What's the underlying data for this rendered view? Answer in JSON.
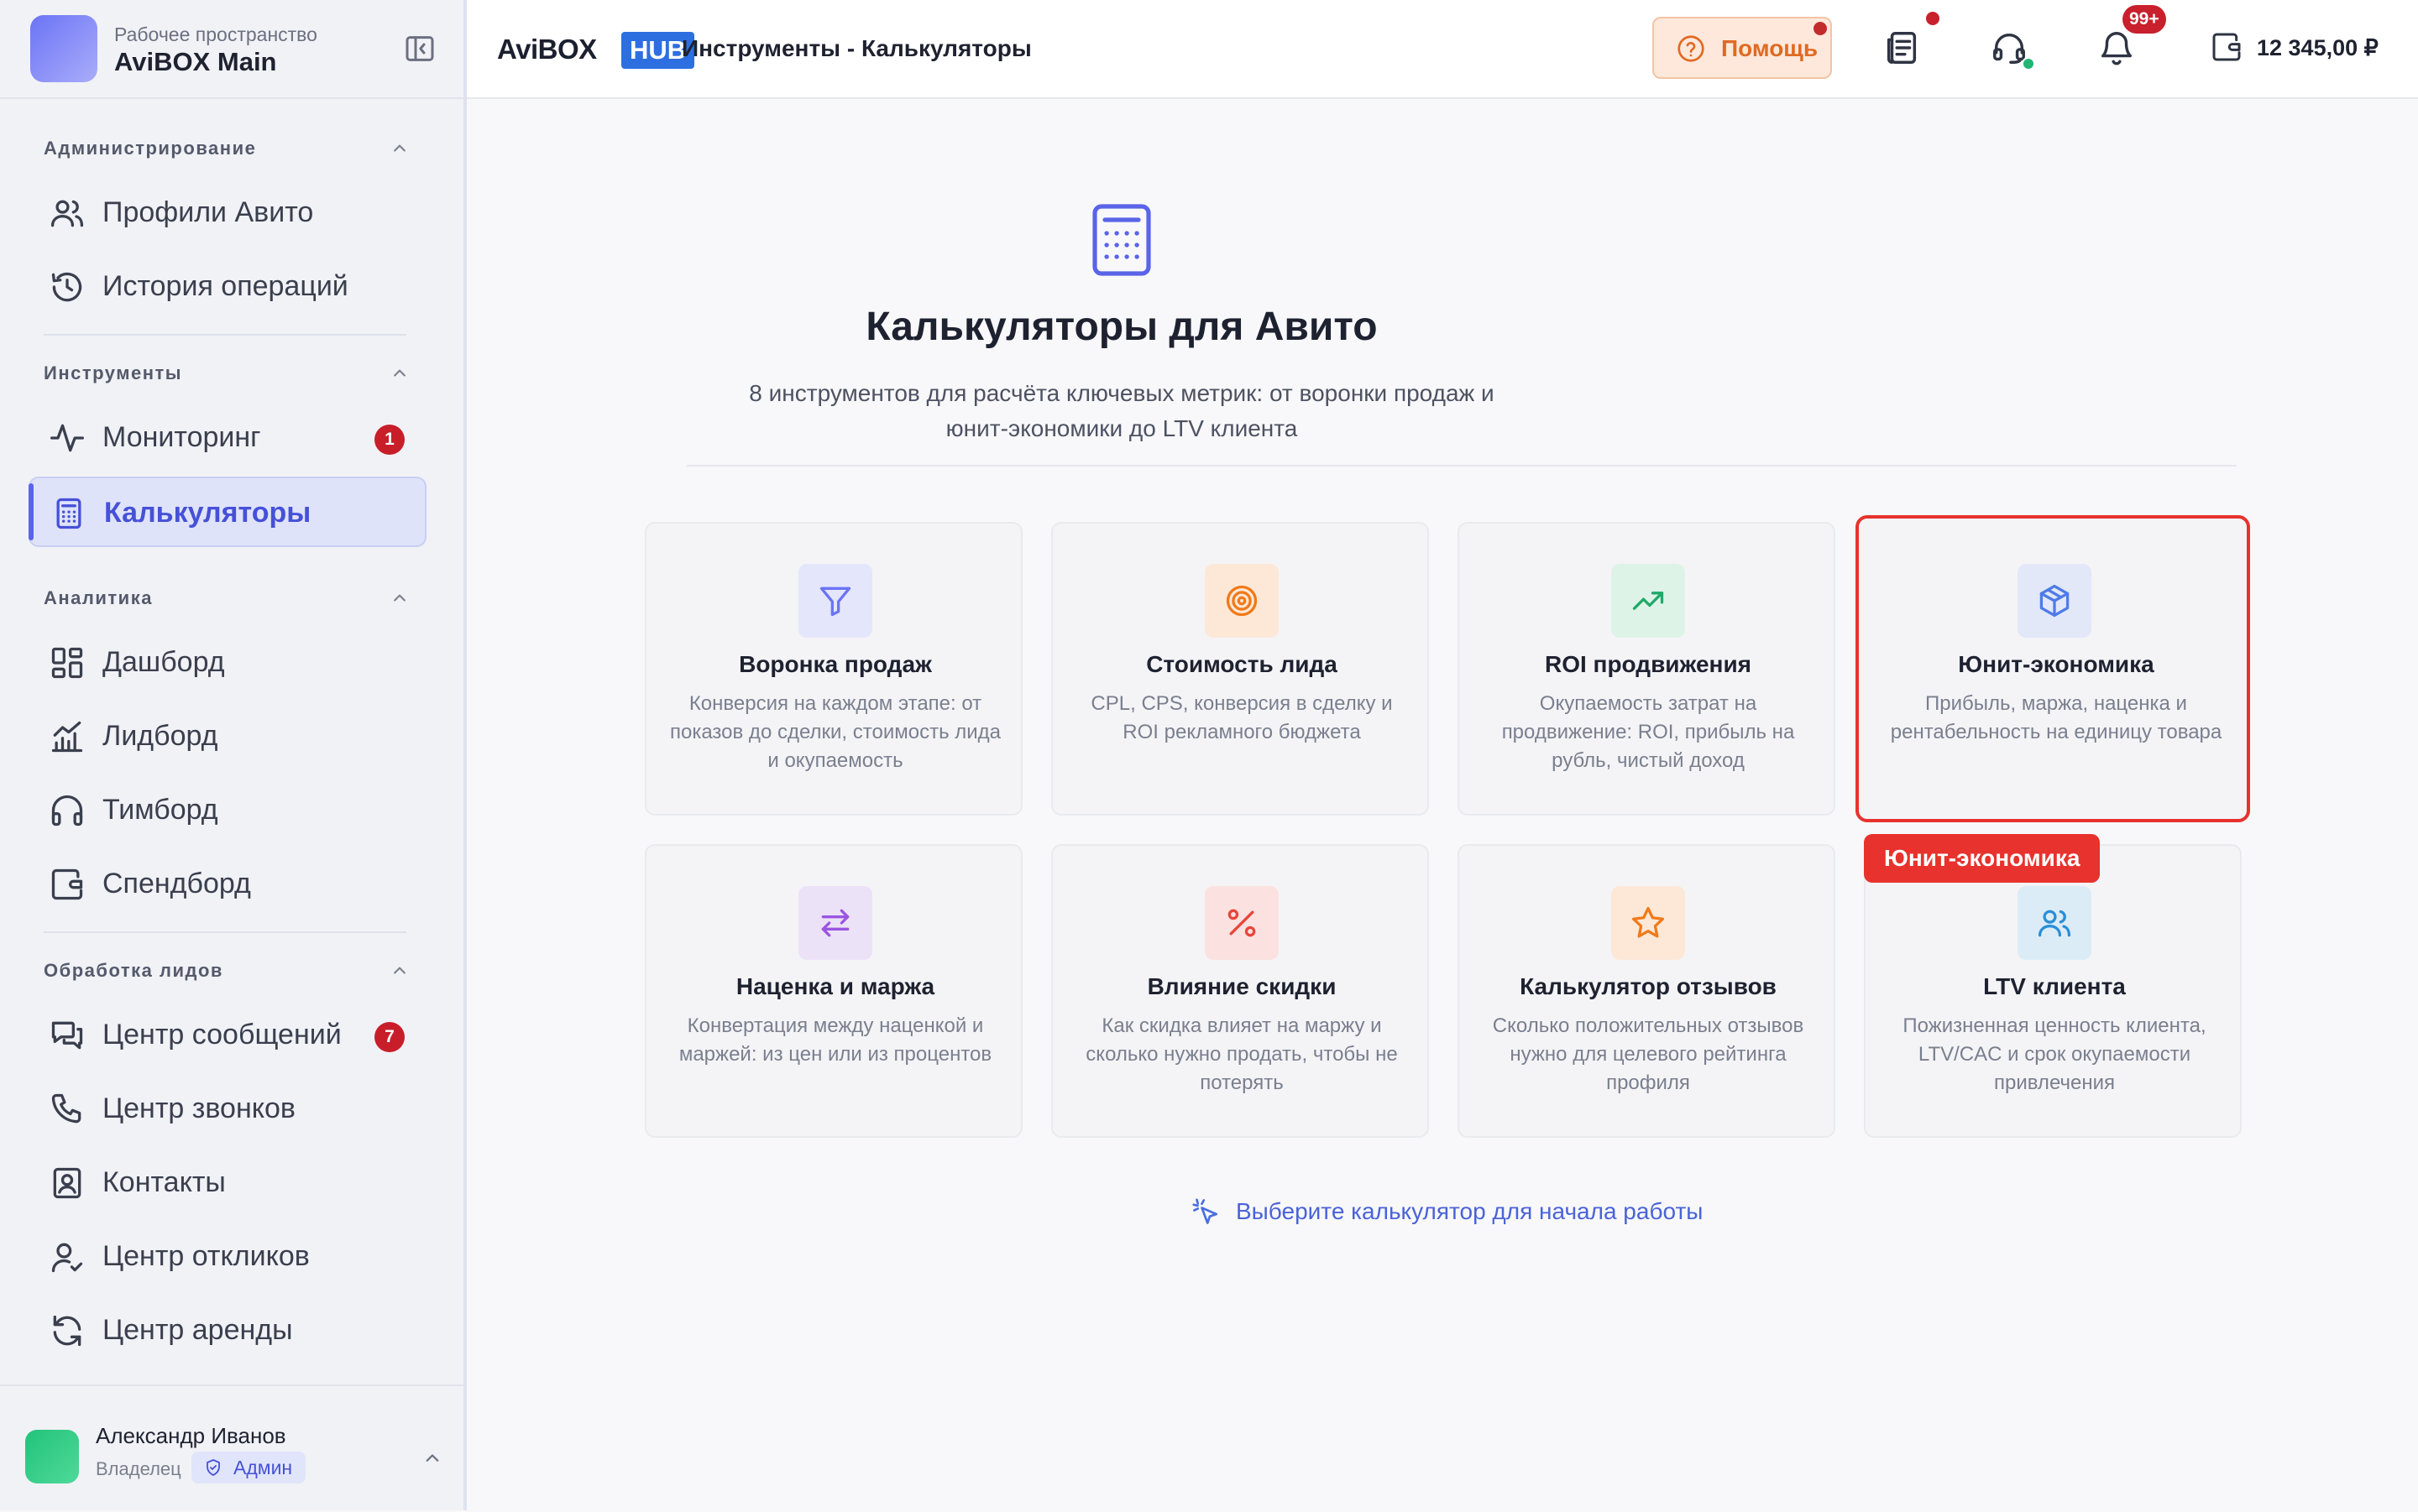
{
  "workspace": {
    "subtitle": "Рабочее пространство",
    "name": "AviBOX Main"
  },
  "sidebar": {
    "sections": [
      {
        "title": "Администрирование",
        "items": [
          {
            "label": "Профили Авито",
            "icon": "users-icon"
          },
          {
            "label": "История операций",
            "icon": "history-icon"
          }
        ]
      },
      {
        "title": "Инструменты",
        "items": [
          {
            "label": "Мониторинг",
            "icon": "activity-icon",
            "badge": "1"
          },
          {
            "label": "Калькуляторы",
            "icon": "calculator-icon",
            "active": true
          }
        ]
      },
      {
        "title": "Аналитика",
        "items": [
          {
            "label": "Дашборд",
            "icon": "dashboard-icon"
          },
          {
            "label": "Лидборд",
            "icon": "bar-chart-icon"
          },
          {
            "label": "Тимборд",
            "icon": "headphones-icon"
          },
          {
            "label": "Спендборд",
            "icon": "wallet-icon"
          }
        ]
      },
      {
        "title": "Обработка лидов",
        "items": [
          {
            "label": "Центр сообщений",
            "icon": "messages-icon",
            "badge": "7"
          },
          {
            "label": "Центр звонков",
            "icon": "phone-icon"
          },
          {
            "label": "Контакты",
            "icon": "contacts-icon"
          },
          {
            "label": "Центр откликов",
            "icon": "user-check-icon"
          },
          {
            "label": "Центр аренды",
            "icon": "refresh-icon"
          }
        ]
      }
    ]
  },
  "user": {
    "name": "Александр Иванов",
    "role": "Владелец",
    "badge": "Админ"
  },
  "header": {
    "brand_avi": "AviBOX",
    "brand_hub": "HUB",
    "breadcrumb": "Инструменты - Калькуляторы",
    "help_label": "Помощь",
    "notifications_badge": "99+",
    "balance": "12 345,00 ₽"
  },
  "main": {
    "title": "Калькуляторы для Авито",
    "subtitle_line1": "8 инструментов для расчёта ключевых метрик: от воронки продаж и",
    "subtitle_line2": "юнит-экономики до LTV клиента",
    "cards": [
      {
        "title": "Воронка продаж",
        "description": "Конверсия на каждом этапе: от показов до сделки, стоимость лида и окупаемость",
        "icon": "filter-icon",
        "color": "#6b74f5",
        "bg": "#e4e6fb"
      },
      {
        "title": "Стоимость лида",
        "description": "CPL, CPS, конверсия в сделку и ROI рекламного бюджета",
        "icon": "target-icon",
        "color": "#f07a1a",
        "bg": "#fde8d8"
      },
      {
        "title": "ROI продвижения",
        "description": "Окупаемость затрат на продвижение: ROI, прибыль на рубль, чистый доход",
        "icon": "trending-up-icon",
        "color": "#1fa968",
        "bg": "#def3e8"
      },
      {
        "title": "Юнит-экономика",
        "description": "Прибыль, маржа, наценка и рентабельность на единицу товара",
        "icon": "box-icon",
        "color": "#4f7be8",
        "bg": "#e2e8f8"
      },
      {
        "title": "Наценка и маржа",
        "description": "Конвертация между наценкой и маржей: из цен или из процентов",
        "icon": "arrows-exchange-icon",
        "color": "#9b55e0",
        "bg": "#ece2f8"
      },
      {
        "title": "Влияние скидки",
        "description": "Как скидка влияет на маржу и сколько нужно продать, чтобы не потерять",
        "icon": "percent-icon",
        "color": "#e8453a",
        "bg": "#fbe2e1"
      },
      {
        "title": "Калькулятор отзывов",
        "description": "Сколько положительных отзывов нужно для целевого рейтинга профиля",
        "icon": "star-icon",
        "color": "#f07a1a",
        "bg": "#fde8d8"
      },
      {
        "title": "LTV клиента",
        "description": "Пожизненная ценность клиента, LTV/CAC и срок окупаемости привлечения",
        "icon": "users-icon",
        "color": "#2a8fd8",
        "bg": "#dcecf7"
      }
    ],
    "tooltip": "Юнит-экономика",
    "hint": "Выберите калькулятор для начала работы"
  }
}
